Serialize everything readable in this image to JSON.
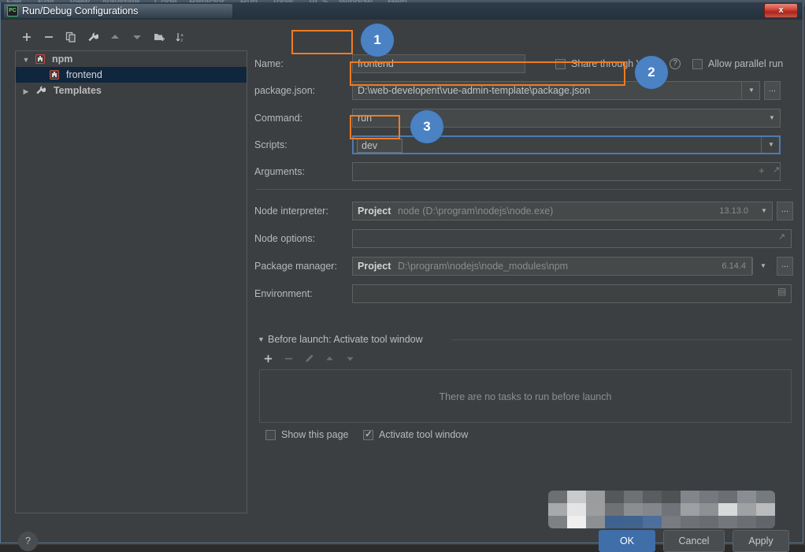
{
  "ide": {
    "menu_items": [
      "File",
      "Edit",
      "View",
      "Navigate",
      "Code",
      "Refactor",
      "Run",
      "Tools",
      "VCS",
      "Window",
      "Help"
    ]
  },
  "window": {
    "title": "Run/Debug Configurations",
    "icon": "pycharm-icon",
    "close_label": "x"
  },
  "tree_toolbar": {
    "buttons": [
      {
        "name": "add-configuration-button",
        "icon": "plus-icon"
      },
      {
        "name": "remove-configuration-button",
        "icon": "minus-icon"
      },
      {
        "name": "copy-configuration-button",
        "icon": "copy-icon"
      },
      {
        "name": "edit-templates-button",
        "icon": "wrench-icon"
      },
      {
        "name": "move-up-button",
        "icon": "arrow-up-icon"
      },
      {
        "name": "move-down-button",
        "icon": "arrow-down-icon"
      },
      {
        "name": "move-into-folder-button",
        "icon": "folder-add-icon"
      },
      {
        "name": "sort-configurations-button",
        "icon": "sort-az-icon"
      }
    ]
  },
  "tree": {
    "nodes": [
      {
        "label": "npm",
        "icon": "npm-icon",
        "twisty": "▼",
        "indent": 0,
        "selected": false,
        "bold": true
      },
      {
        "label": "frontend",
        "icon": "npm-icon",
        "twisty": "",
        "indent": 1,
        "selected": true,
        "bold": false
      },
      {
        "label": "Templates",
        "icon": "wrench-icon",
        "twisty": "▶",
        "indent": 0,
        "selected": false,
        "bold": true
      }
    ]
  },
  "form": {
    "name": {
      "label": "Name:",
      "value": "frontend"
    },
    "share_vcs": {
      "label": "Share through VCS",
      "checked": false,
      "help_icon": "question-mark-icon"
    },
    "allow_parallel": {
      "label": "Allow parallel run",
      "checked": false
    },
    "package_json": {
      "label": "package.json:",
      "value": "D:\\web-developent\\vue-admin-template\\package.json",
      "dropdown_icon": "chevron-down-icon",
      "browse_label": "..."
    },
    "command": {
      "label": "Command:",
      "value": "run",
      "dropdown_icon": "chevron-down-icon"
    },
    "scripts": {
      "label": "Scripts:",
      "value": "dev",
      "dropdown_icon": "chevron-down-icon"
    },
    "arguments": {
      "label": "Arguments:",
      "value": "",
      "add_icon": "plus-icon",
      "expand_icon": "expand-icon"
    },
    "node_interpreter": {
      "label": "Node interpreter:",
      "scope": "Project",
      "value": "node (D:\\program\\nodejs\\node.exe)",
      "version": "13.13.0",
      "dropdown_icon": "chevron-down-icon",
      "browse_label": "..."
    },
    "node_options": {
      "label": "Node options:",
      "value": "",
      "expand_icon": "expand-icon"
    },
    "package_manager": {
      "label": "Package manager:",
      "scope": "Project",
      "value": "D:\\program\\nodejs\\node_modules\\npm",
      "version": "6.14.4",
      "dropdown_icon": "chevron-down-icon",
      "browse_label": "..."
    },
    "environment": {
      "label": "Environment:",
      "value": "",
      "editor_icon": "list-editor-icon"
    }
  },
  "before_launch": {
    "twisty": "▼",
    "title": "Before launch: Activate tool window",
    "toolbar": [
      {
        "name": "add-task-button",
        "icon": "plus-icon",
        "enabled": true
      },
      {
        "name": "remove-task-button",
        "icon": "minus-icon",
        "enabled": false
      },
      {
        "name": "edit-task-button",
        "icon": "pencil-icon",
        "enabled": false
      },
      {
        "name": "task-move-up-button",
        "icon": "arrow-up-icon",
        "enabled": false
      },
      {
        "name": "task-move-down-button",
        "icon": "arrow-down-icon",
        "enabled": false
      }
    ],
    "empty_text": "There are no tasks to run before launch",
    "show_this_page": {
      "label": "Show this page",
      "checked": false
    },
    "activate_tool_window": {
      "label": "Activate tool window",
      "checked": true
    }
  },
  "footer": {
    "help_label": "?",
    "ok_label": "OK",
    "cancel_label": "Cancel",
    "apply_label": "Apply"
  },
  "annotations": {
    "badges": [
      {
        "label": "1",
        "target": "name-field"
      },
      {
        "label": "2",
        "target": "package-json-field"
      },
      {
        "label": "3",
        "target": "scripts-field"
      }
    ],
    "highlight_color": "#f07b22",
    "badge_color": "#4a82c4"
  }
}
